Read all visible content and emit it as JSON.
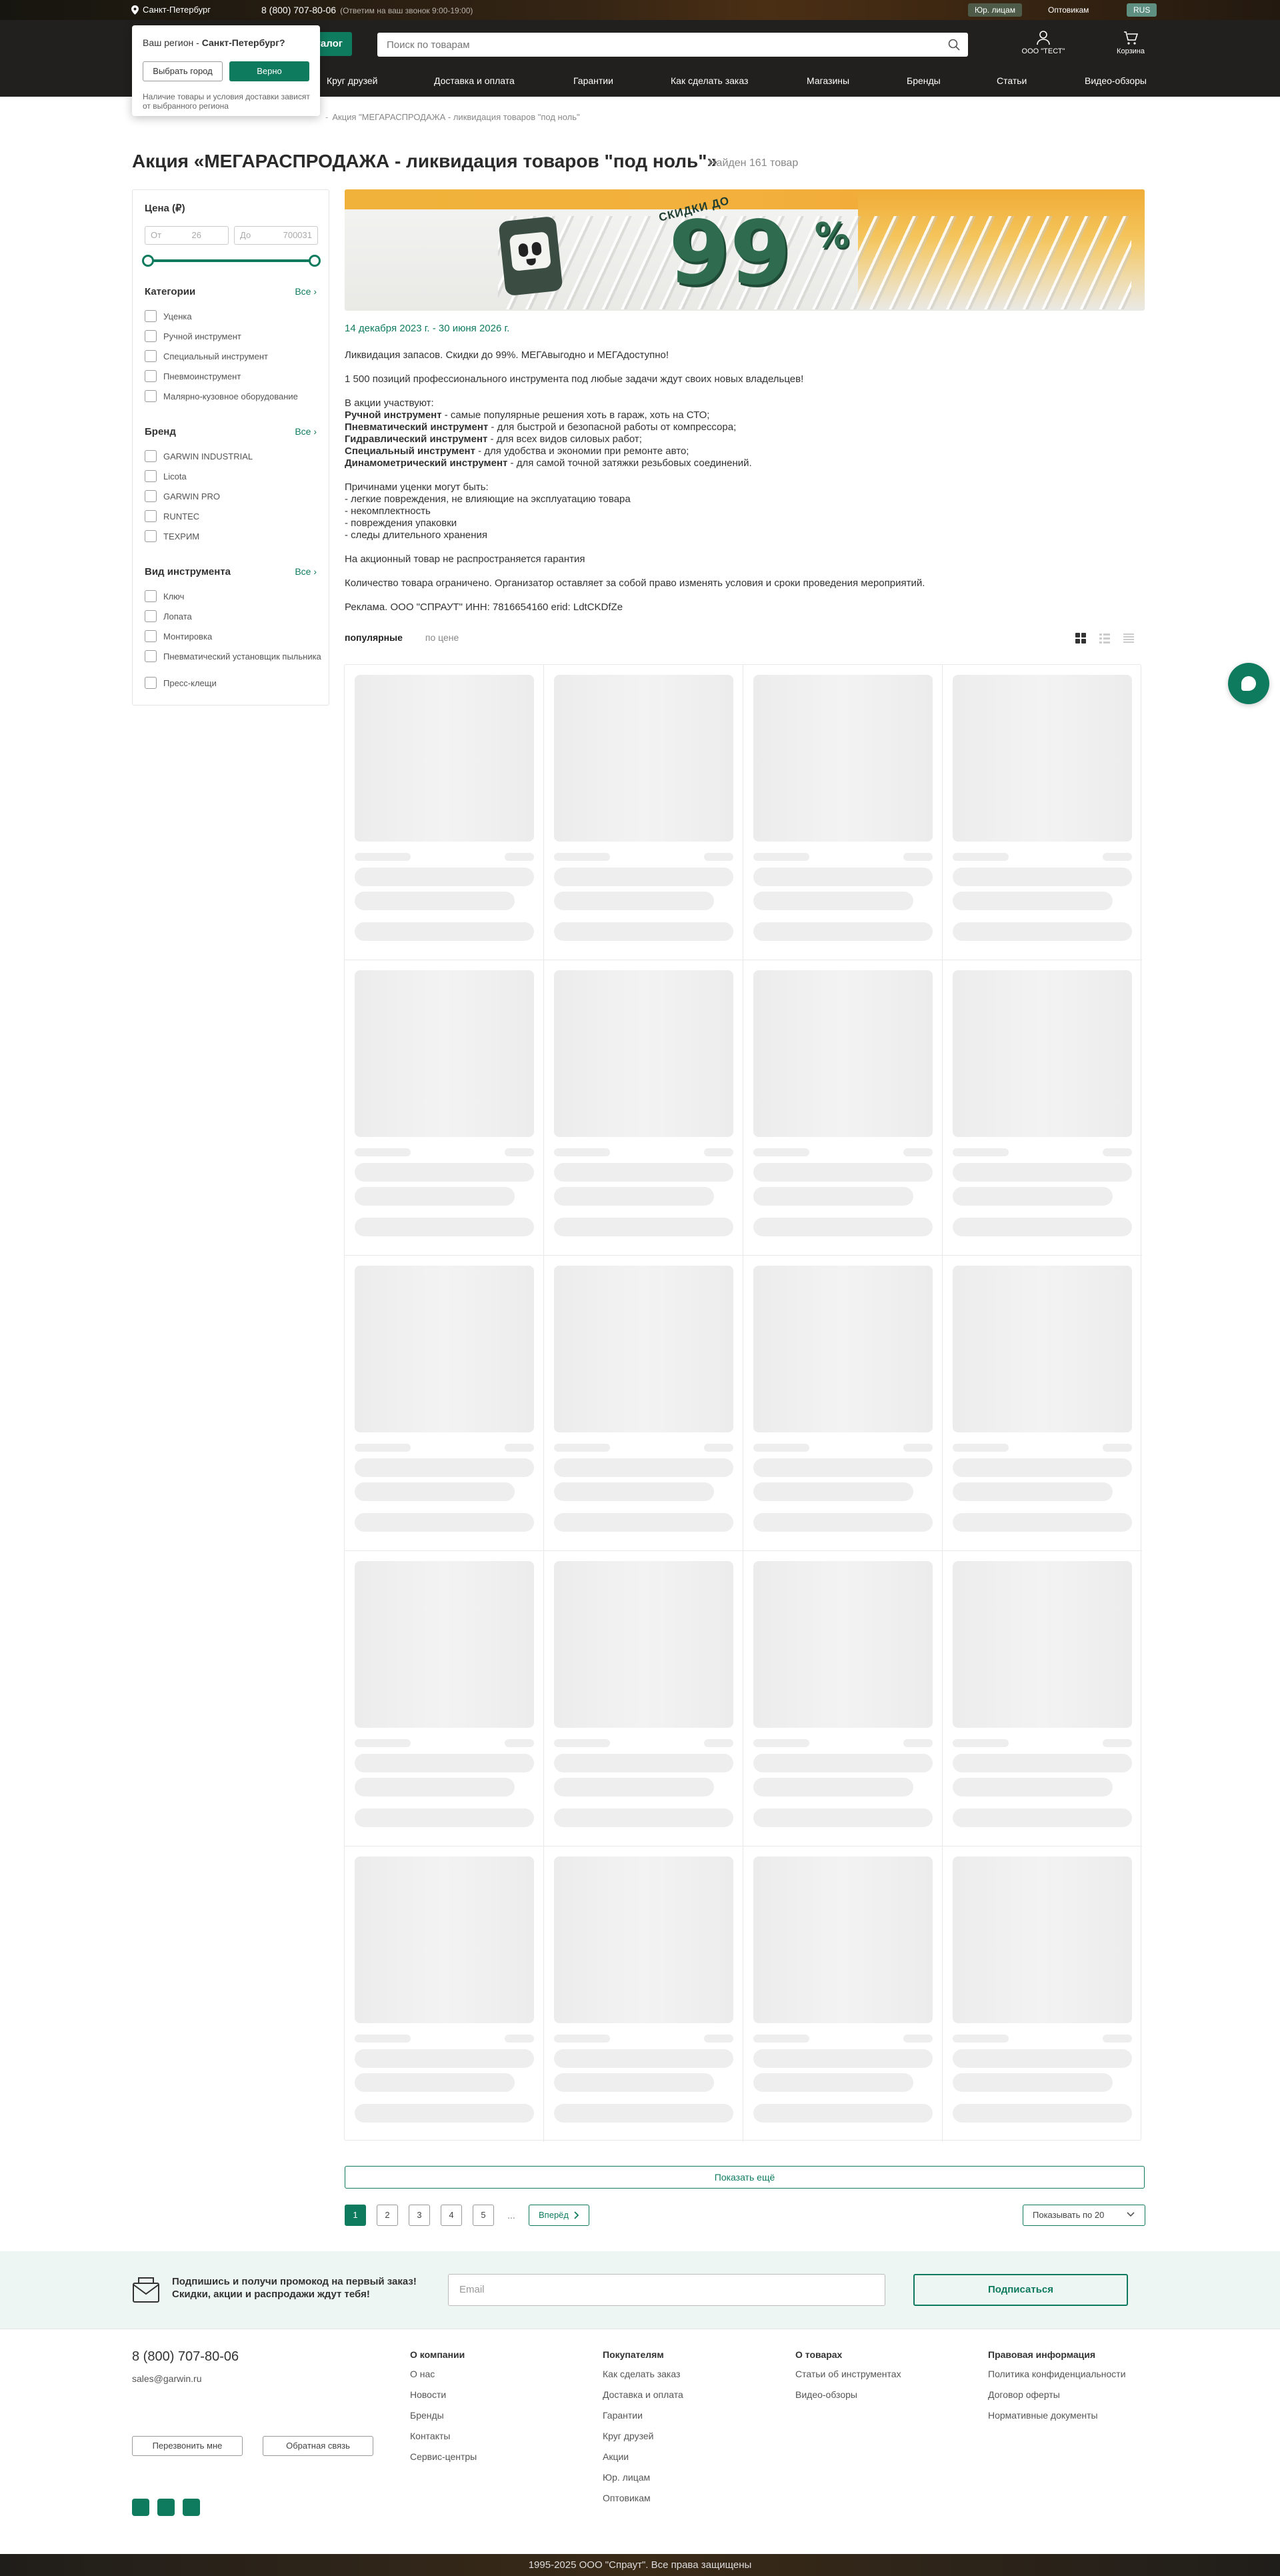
{
  "header": {
    "city": "Санкт-Петербург",
    "phone": "8 (800) 707-80-06",
    "phone_note": "(Ответим на ваш звонок 9:00-19:00)",
    "ur_label": "Юр. лицам",
    "opt_label": "Оптовикам",
    "lang": "RUS",
    "catalog_label": "Каталог",
    "search_placeholder": "Поиск по товарам",
    "user_label": "ООО \"ТЕСТ\"",
    "cart_label": "Корзина",
    "nav": [
      "Круг друзей",
      "Доставка и оплата",
      "Гарантии",
      "Как сделать заказ",
      "Магазины",
      "Бренды",
      "Статьи",
      "Видео-обзоры"
    ]
  },
  "region_popup": {
    "question_prefix": "Ваш регион - ",
    "question_city": "Санкт-Петербург?",
    "choose_label": "Выбрать город",
    "yes_label": "Верно",
    "note": "Наличие товары и условия доставки зависят от выбранного региона"
  },
  "breadcrumb": {
    "current": "Акция \"МЕГАРАСПРОДАЖА - ликвидация товаров \"под ноль\""
  },
  "page": {
    "title": "Акция «МЕГАРАСПРОДАЖА - ликвидация товаров \"под ноль\"»",
    "found": "Найден 161 товар"
  },
  "filters": {
    "price_title": "Цена (₽)",
    "from_label": "От",
    "from_value": "26",
    "to_label": "До",
    "to_value": "700031",
    "all_label": "Все ›",
    "categories_title": "Категории",
    "categories": [
      "Уценка",
      "Ручной инструмент",
      "Специальный инструмент",
      "Пневмоинструмент",
      "Малярно-кузовное оборудование"
    ],
    "brand_title": "Бренд",
    "brands": [
      "GARWIN INDUSTRIAL",
      "Licota",
      "GARWIN PRO",
      "RUNTEC",
      "ТЕХРИМ"
    ],
    "tool_title": "Вид инструмента",
    "tools": [
      "Ключ",
      "Лопата",
      "Монтировка",
      "Пневматический установщик пыльника",
      "Пресс-клещи"
    ]
  },
  "banner": {
    "skidki": "СКИДКИ ДО",
    "big": "99",
    "pct": "%"
  },
  "promo": {
    "date": "14 декабря 2023 г. - 30 июня 2026 г.",
    "p1": "Ликвидация запасов. Скидки до 99%. МЕГАвыгодно и МЕГАдоступно!",
    "p2": "1 500 позиций профессионального инструмента под любые задачи ждут своих новых владельцев!",
    "p3_intro": "В акции участвуют:",
    "participants": [
      {
        "b": "Ручной инструмент",
        "t": " - самые популярные решения хоть в гараж, хоть на СТО;"
      },
      {
        "b": "Пневматический инструмент",
        "t": " - для быстрой и безопасной работы от компрессора;"
      },
      {
        "b": "Гидравлический инструмент",
        "t": " - для всех видов силовых работ;"
      },
      {
        "b": "Специальный инструмент",
        "t": " - для удобства и экономии при ремонте авто;"
      },
      {
        "b": "Динамометрический инструмент",
        "t": " - для самой точной затяжки резьбовых соединений."
      }
    ],
    "reasons_intro": "Причинами уценки могут быть:",
    "reasons": [
      "- легкие повреждения, не влияющие на эксплуатацию товара",
      "- некомплектность",
      "- повреждения упаковки",
      "- следы длительного хранения"
    ],
    "p5": "На акционный товар не распространяется гарантия",
    "p6": "Количество товара ограничено. Организатор оставляет за собой право изменять условия и сроки проведения мероприятий.",
    "p7": "Реклама. ООО \"СПРАУТ\" ИНН: 7816654160 erid: LdtCKDfZe"
  },
  "sort": {
    "popular": "популярные",
    "price": "по цене"
  },
  "pagination": {
    "more_label": "Показать ещё",
    "pages": [
      "1",
      "2",
      "3",
      "4",
      "5"
    ],
    "dots": "...",
    "next_label": "Вперёд",
    "per_page_label": "Показывать по 20"
  },
  "subscribe": {
    "line1": "Подпишись и получи промокод на первый заказ!",
    "line2": "Скидки, акции и распродажи ждут тебя!",
    "email_placeholder": "Email",
    "button_label": "Подписаться"
  },
  "footer": {
    "phone": "8 (800) 707-80-06",
    "email": "sales@garwin.ru",
    "callback_label": "Перезвонить мне",
    "feedback_label": "Обратная связь",
    "columns": [
      {
        "title": "О компании",
        "items": [
          "О нас",
          "Новости",
          "Бренды",
          "Контакты",
          "Сервис-центры"
        ]
      },
      {
        "title": "Покупателям",
        "items": [
          "Как сделать заказ",
          "Доставка и оплата",
          "Гарантии",
          "Круг друзей",
          "Акции",
          "Юр. лицам",
          "Оптовикам"
        ]
      },
      {
        "title": "О товарах",
        "items": [
          "Статьи об инструментах",
          "Видео-обзоры"
        ]
      },
      {
        "title": "Правовая информация",
        "items": [
          "Политика конфиденциальности",
          "Договор оферты",
          "Нормативные документы"
        ]
      }
    ],
    "copyright": "1995-2025 ООО \"Спраут\". Все права защищены"
  },
  "colors": {
    "accent": "#0f7b5e",
    "header_bg": "#22201e"
  }
}
